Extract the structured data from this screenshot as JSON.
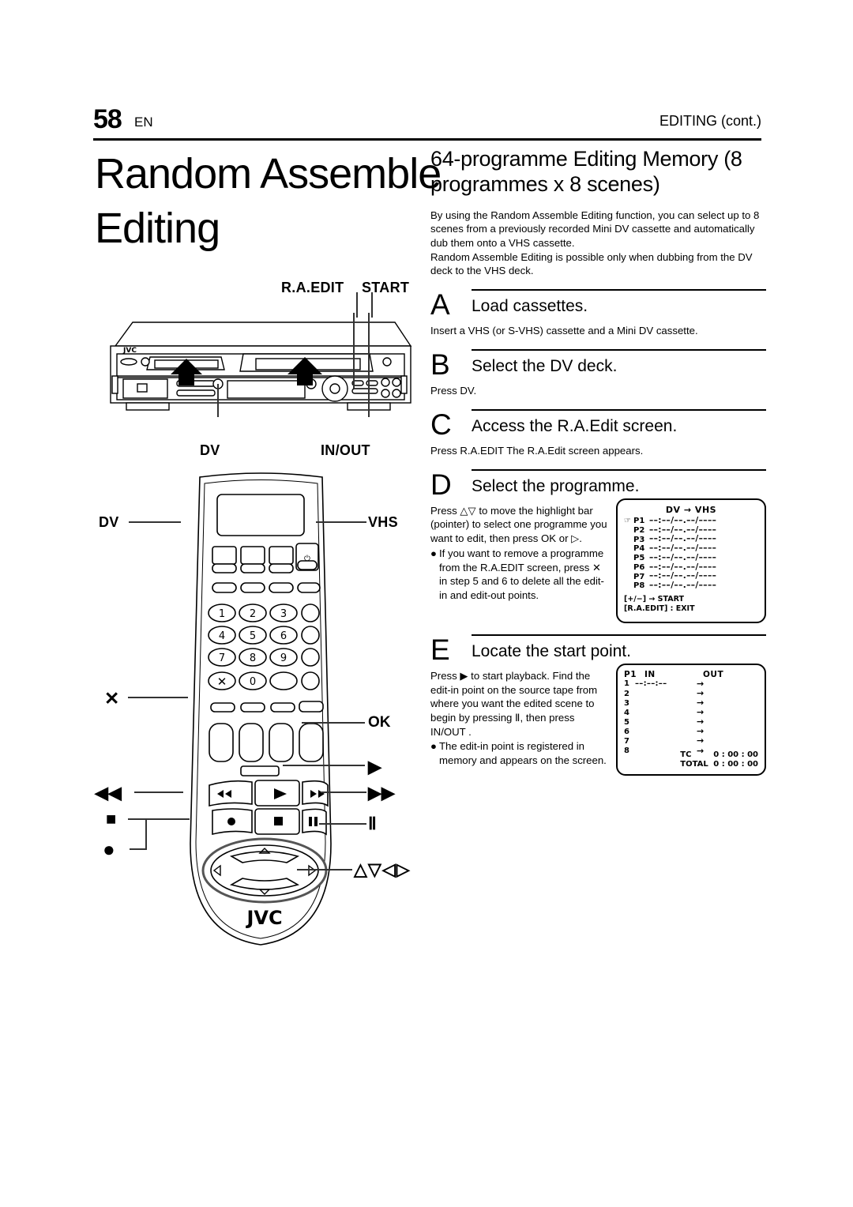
{
  "header": {
    "page_number": "58",
    "page_lang": "EN",
    "section": "EDITING (cont.)"
  },
  "title": "Random Assemble Editing",
  "subtitle": "64-programme Editing Memory (8 programmes x 8 scenes)",
  "intro": [
    "By using the Random Assemble Editing function, you can select up to 8 scenes from a previously recorded Mini DV cassette and automatically dub them onto a VHS cassette.",
    "Random Assemble Editing is possible only when dubbing from the DV deck to the VHS deck."
  ],
  "steps": [
    {
      "letter": "A",
      "title": "Load cassettes.",
      "body": "Insert a VHS (or S-VHS) cassette and a Mini DV cassette."
    },
    {
      "letter": "B",
      "title": "Select the DV deck.",
      "body": "Press DV."
    },
    {
      "letter": "C",
      "title": "Access the R.A.Edit screen.",
      "body": "Press R.A.EDIT The R.A.Edit screen appears."
    },
    {
      "letter": "D",
      "title": "Select the programme.",
      "body": "Press △▽ to move the highlight bar (pointer) to select one programme you want to edit, then press OK or ▷.",
      "bullet": "If you want to remove a programme from the R.A.EDIT screen, press ✕ in step 5 and 6 to delete all the edit-in and edit-out points."
    },
    {
      "letter": "E",
      "title": "Locate the start point.",
      "body": "Press ▶ to start playback. Find the edit-in point on the source tape from where you want the edited scene to begin by pressing Ⅱ, then press IN/OUT .",
      "bullet": "The edit-in point is registered in memory and appears on the screen."
    }
  ],
  "osd_program_list": {
    "title": "DV → VHS",
    "pointer_icon": "pointer-hand-icon",
    "rows": [
      {
        "label": "P1",
        "value": "––:––/––.––/––––",
        "selected": true
      },
      {
        "label": "P2",
        "value": "––:––/––.––/––––",
        "selected": false
      },
      {
        "label": "P3",
        "value": "––:––/––.––/––––",
        "selected": false
      },
      {
        "label": "P4",
        "value": "––:––/––.––/––––",
        "selected": false
      },
      {
        "label": "P5",
        "value": "––:––/––.––/––––",
        "selected": false
      },
      {
        "label": "P6",
        "value": "––:––/––.––/––––",
        "selected": false
      },
      {
        "label": "P7",
        "value": "––:––/––.––/––––",
        "selected": false
      },
      {
        "label": "P8",
        "value": "––:––/––.––/––––",
        "selected": false
      }
    ],
    "footer_line1": "[+/−] → START",
    "footer_line2": "[R.A.EDIT] : EXIT"
  },
  "osd_in_out": {
    "program_label": "P1",
    "col_in": "IN",
    "col_out": "OUT",
    "rows": [
      {
        "n": "1",
        "in": "––:––:––",
        "arrow": "→"
      },
      {
        "n": "2",
        "in": "",
        "arrow": "→"
      },
      {
        "n": "3",
        "in": "",
        "arrow": "→"
      },
      {
        "n": "4",
        "in": "",
        "arrow": "→"
      },
      {
        "n": "5",
        "in": "",
        "arrow": "→"
      },
      {
        "n": "6",
        "in": "",
        "arrow": "→"
      },
      {
        "n": "7",
        "in": "",
        "arrow": "→"
      },
      {
        "n": "8",
        "in": "",
        "arrow": "→"
      }
    ],
    "tc_label": "TC",
    "tc_value": "0 : 00 : 00",
    "total_label": "TOTAL",
    "total_value": "0 : 00 : 00"
  },
  "callouts": {
    "ra_edit": "R.A.EDIT",
    "start": "START",
    "dv_deck": "DV",
    "in_out": "IN/OUT",
    "dv_remote": "DV",
    "vhs_remote": "VHS",
    "cancel": "✕",
    "ok": "OK",
    "play": "▶",
    "rew": "◀◀",
    "ff": "▶▶",
    "stop": "■",
    "pause": "Ⅱ",
    "record": "●",
    "arrows": "△▽◁▷"
  },
  "device": {
    "brand": "JVC",
    "remote_brand": "JVC",
    "keypad": [
      "1",
      "2",
      "3",
      "4",
      "5",
      "6",
      "7",
      "8",
      "9",
      "0"
    ]
  }
}
